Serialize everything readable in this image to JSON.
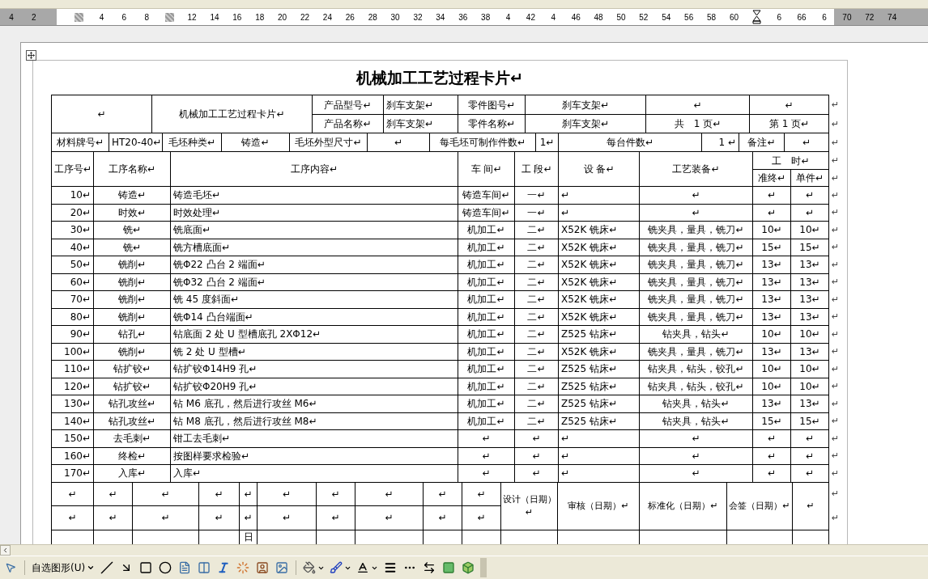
{
  "ruler": {
    "items": [
      {
        "kind": "number",
        "label": "4"
      },
      {
        "kind": "number",
        "label": "2"
      },
      {
        "kind": "blank"
      },
      {
        "kind": "marker"
      },
      {
        "kind": "number",
        "label": "4"
      },
      {
        "kind": "number",
        "label": "6"
      },
      {
        "kind": "number",
        "label": "8"
      },
      {
        "kind": "marker"
      },
      {
        "kind": "number",
        "label": "12"
      },
      {
        "kind": "number",
        "label": "14"
      },
      {
        "kind": "number",
        "label": "16"
      },
      {
        "kind": "number",
        "label": "18"
      },
      {
        "kind": "number",
        "label": "20"
      },
      {
        "kind": "number",
        "label": "22"
      },
      {
        "kind": "number",
        "label": "24"
      },
      {
        "kind": "number",
        "label": "26"
      },
      {
        "kind": "number",
        "label": "28"
      },
      {
        "kind": "number",
        "label": "30"
      },
      {
        "kind": "number",
        "label": "32"
      },
      {
        "kind": "number",
        "label": "34"
      },
      {
        "kind": "number",
        "label": "36"
      },
      {
        "kind": "number",
        "label": "38"
      },
      {
        "kind": "number",
        "label": "4"
      },
      {
        "kind": "number",
        "label": "42"
      },
      {
        "kind": "number",
        "label": "4"
      },
      {
        "kind": "number",
        "label": "46"
      },
      {
        "kind": "number",
        "label": "48"
      },
      {
        "kind": "number",
        "label": "50"
      },
      {
        "kind": "number",
        "label": "52"
      },
      {
        "kind": "number",
        "label": "54"
      },
      {
        "kind": "number",
        "label": "56"
      },
      {
        "kind": "number",
        "label": "58"
      },
      {
        "kind": "number",
        "label": "60"
      },
      {
        "kind": "indent"
      },
      {
        "kind": "number",
        "label": "6"
      },
      {
        "kind": "number",
        "label": "66"
      },
      {
        "kind": "number",
        "label": "6"
      },
      {
        "kind": "number",
        "label": "70"
      },
      {
        "kind": "number",
        "label": "72"
      },
      {
        "kind": "number",
        "label": "74"
      }
    ]
  },
  "document": {
    "title": "机械加工工艺过程卡片↵",
    "header_table": {
      "rows": [
        {
          "cells": [
            {
              "text": "↵",
              "rowspan": 2
            },
            {
              "text": "机械加工工艺过程卡片↵",
              "rowspan": 2
            },
            "产品型号↵",
            "刹车支架↵",
            "零件图号↵",
            "刹车支架↵",
            "↵",
            "↵"
          ],
          "end": "↵"
        },
        {
          "cells": [
            "产品名称↵",
            "刹车支架↵",
            "零件名称↵",
            "刹车支架↵",
            "共　1 页↵",
            "第 1 页↵"
          ],
          "end": "↵"
        }
      ]
    },
    "material_row": {
      "cells": [
        "材料牌号↵",
        "HT20-40↵",
        "毛坯种类↵",
        "铸造↵",
        "毛坯外型尺寸↵",
        "↵",
        "每毛坯可制作件数↵",
        "1↵",
        "每台件数↵",
        "1 ↵",
        "备注↵",
        "↵"
      ],
      "end": "↵"
    },
    "process_table": {
      "header_rows": [
        {
          "cells": [
            {
              "text": "工序号↵",
              "rowspan": 2
            },
            {
              "text": "工序名称↵",
              "rowspan": 2
            },
            {
              "text": "工序内容↵",
              "rowspan": 2
            },
            {
              "text": "车 间↵",
              "rowspan": 2
            },
            {
              "text": "工 段↵",
              "rowspan": 2
            },
            {
              "text": "设 备↵",
              "rowspan": 2
            },
            {
              "text": "工艺装备↵",
              "rowspan": 2
            },
            {
              "text": "工　时↵",
              "colspan": 2
            }
          ],
          "end": "↵"
        },
        {
          "cells": [
            "准终↵",
            "单件↵"
          ],
          "end": "↵"
        }
      ],
      "rows": [
        {
          "cells": [
            "10↵",
            "铸造↵",
            "铸造毛坯↵",
            "铸造车间↵",
            "一↵",
            "↵",
            "↵",
            "↵",
            "↵"
          ],
          "end": "↵"
        },
        {
          "cells": [
            "20↵",
            "时效↵",
            "时效处理↵",
            "铸造车间↵",
            "一↵",
            "↵",
            "↵",
            "↵",
            "↵"
          ],
          "end": "↵"
        },
        {
          "cells": [
            "30↵",
            "铣↵",
            "铣底面↵",
            "机加工↵",
            "二↵",
            "X52K 铣床↵",
            "铣夹具，量具，铣刀↵",
            "10↵",
            "10↵"
          ],
          "end": "↵"
        },
        {
          "cells": [
            "40↵",
            "铣↵",
            "铣方槽底面↵",
            "机加工↵",
            "二↵",
            "X52K 铣床↵",
            "铣夹具，量具，铣刀↵",
            "15↵",
            "15↵"
          ],
          "end": "↵"
        },
        {
          "cells": [
            "50↵",
            "铣削↵",
            "铣Φ22 凸台 2 端面↵",
            "机加工↵",
            "二↵",
            "X52K 铣床↵",
            "铣夹具，量具，铣刀↵",
            "13↵",
            "13↵"
          ],
          "end": "↵"
        },
        {
          "cells": [
            "60↵",
            "铣削↵",
            "铣Φ32 凸台 2 端面↵",
            "机加工↵",
            "二↵",
            "X52K 铣床↵",
            "铣夹具，量具，铣刀↵",
            "13↵",
            "13↵"
          ],
          "end": "↵"
        },
        {
          "cells": [
            "70↵",
            "铣削↵",
            "铣 45 度斜面↵",
            "机加工↵",
            "二↵",
            "X52K 铣床↵",
            "铣夹具，量具，铣刀↵",
            "13↵",
            "13↵"
          ],
          "end": "↵"
        },
        {
          "cells": [
            "80↵",
            "铣削↵",
            "铣Φ14 凸台端面↵",
            "机加工↵",
            "二↵",
            "X52K 铣床↵",
            "铣夹具，量具，铣刀↵",
            "13↵",
            "13↵"
          ],
          "end": "↵"
        },
        {
          "cells": [
            "90↵",
            "钻孔↵",
            "钻底面 2 处 U 型槽底孔 2XΦ12↵",
            "机加工↵",
            "二↵",
            "Z525 钻床↵",
            "钻夹具，钻头↵",
            "10↵",
            "10↵"
          ],
          "end": "↵"
        },
        {
          "cells": [
            "100↵",
            "铣削↵",
            "铣 2 处 U 型槽↵",
            "机加工↵",
            "二↵",
            "X52K 铣床↵",
            "铣夹具，量具，铣刀↵",
            "13↵",
            "13↵"
          ],
          "end": "↵"
        },
        {
          "cells": [
            "110↵",
            "钻扩铰↵",
            "钻扩铰Φ14H9 孔↵",
            "机加工↵",
            "二↵",
            "Z525 钻床↵",
            "钻夹具，钻头，铰孔↵",
            "10↵",
            "10↵"
          ],
          "end": "↵"
        },
        {
          "cells": [
            "120↵",
            "钻扩铰↵",
            "钻扩铰Φ20H9 孔↵",
            "机加工↵",
            "二↵",
            "Z525 钻床↵",
            "钻夹具，钻头，铰孔↵",
            "10↵",
            "10↵"
          ],
          "end": "↵"
        },
        {
          "cells": [
            "130↵",
            "钻孔攻丝↵",
            "钻 M6 底孔，然后进行攻丝 M6↵",
            "机加工↵",
            "二↵",
            "Z525 钻床↵",
            "钻夹具，钻头↵",
            "13↵",
            "13↵"
          ],
          "end": "↵"
        },
        {
          "cells": [
            "140↵",
            "钻孔攻丝↵",
            "钻 M8 底孔，然后进行攻丝 M8↵",
            "机加工↵",
            "二↵",
            "Z525 钻床↵",
            "钻夹具，钻头↵",
            "15↵",
            "15↵"
          ],
          "end": "↵"
        },
        {
          "cells": [
            "150↵",
            "去毛刺↵",
            "钳工去毛刺↵",
            "↵",
            "↵",
            "↵",
            "↵",
            "↵",
            "↵"
          ],
          "end": "↵"
        },
        {
          "cells": [
            "160↵",
            "终检↵",
            "按图样要求检验↵",
            "↵",
            "↵",
            "↵",
            "↵",
            "↵",
            "↵"
          ],
          "end": "↵"
        },
        {
          "cells": [
            "170↵",
            "入库↵",
            "入库↵",
            "↵",
            "↵",
            "↵",
            "↵",
            "↵",
            "↵"
          ],
          "end": "↵"
        }
      ]
    },
    "signoff_table": {
      "rows": [
        {
          "cells": [
            "↵",
            "↵",
            "↵",
            "↵",
            "↵",
            "↵",
            "↵",
            "↵",
            "↵",
            "↵",
            {
              "text": "设计（日期）↵",
              "rowspan": 2
            },
            {
              "text": "审核（日期）↵",
              "rowspan": 2
            },
            {
              "text": "标准化（日期）↵",
              "rowspan": 2
            },
            {
              "text": "会签（日期）↵",
              "rowspan": 2
            },
            {
              "text": "↵",
              "rowspan": 2
            }
          ],
          "end": "↵"
        },
        {
          "cells": [
            "↵",
            "↵",
            "↵",
            "↵",
            "↵",
            "↵",
            "↵",
            "↵",
            "↵",
            "↵"
          ],
          "end": "↵"
        }
      ],
      "cut_row": {
        "day_label": "日"
      }
    }
  },
  "drawing_toolbar": {
    "autoshapes": "自选图形(U)"
  }
}
